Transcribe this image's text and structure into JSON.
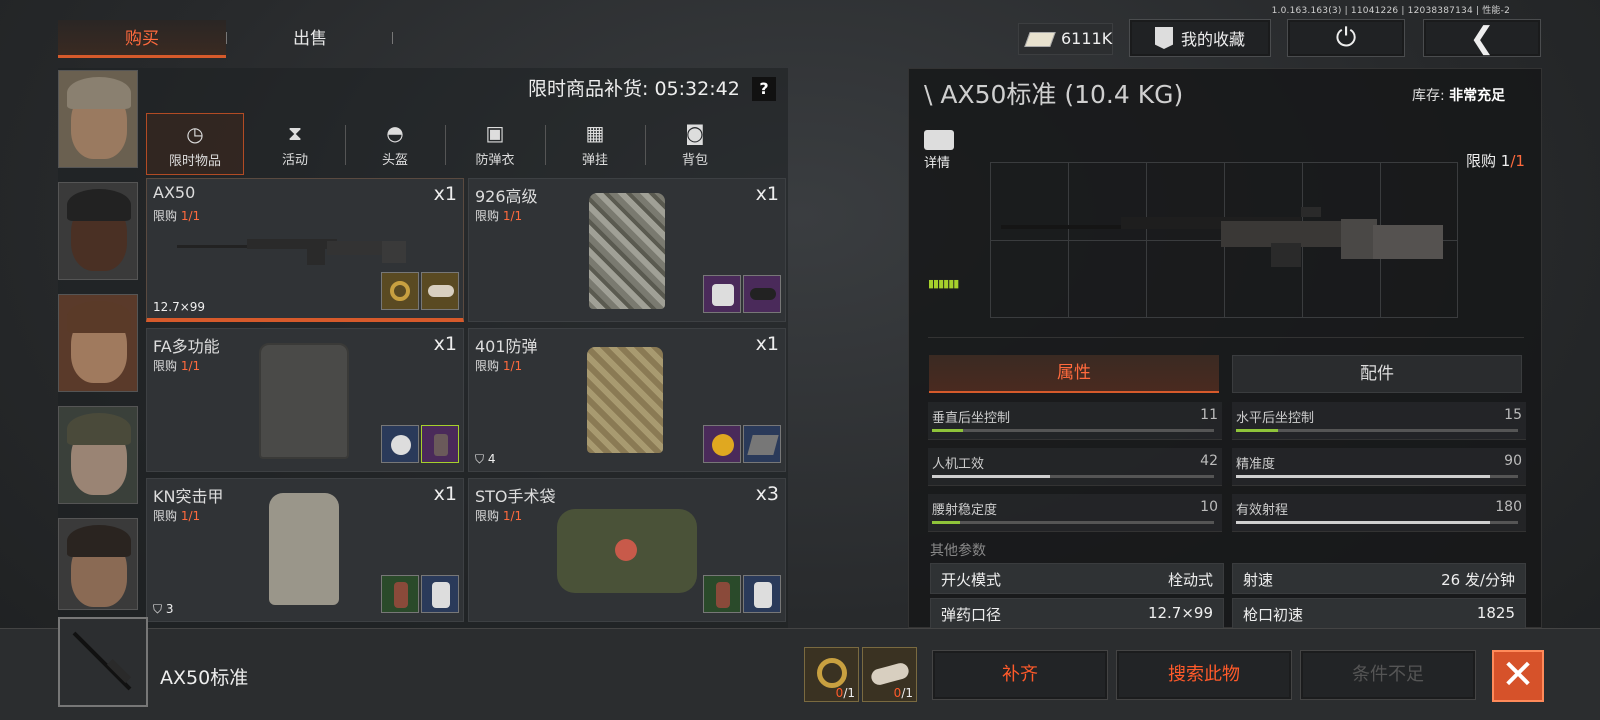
{
  "version": "1.0.163.163(3) | 11041226 | 12038387134 | 性能-2",
  "top_tabs": [
    {
      "label": "购买"
    },
    {
      "label": "出售"
    }
  ],
  "currency": {
    "value": "6111K"
  },
  "favorites": {
    "label": "我的收藏"
  },
  "restock": {
    "label": "限时商品补货:",
    "time": "05:32:42",
    "help": "?"
  },
  "categories": [
    {
      "label": "限时物品",
      "icon": "clock-icon"
    },
    {
      "label": "活动",
      "icon": "event-icon"
    },
    {
      "label": "头盔",
      "icon": "helmet-icon"
    },
    {
      "label": "防弹衣",
      "icon": "vest-icon"
    },
    {
      "label": "弹挂",
      "icon": "rig-icon"
    },
    {
      "label": "背包",
      "icon": "backpack-icon"
    }
  ],
  "items": [
    {
      "name": "AX50",
      "limit_label": "限购",
      "limit": "1/1",
      "qty": "x1",
      "tag": "12.7×99",
      "armor": "",
      "colors": [
        "#5a4a22",
        "#5a4a22"
      ]
    },
    {
      "name": "926高级",
      "limit_label": "限购",
      "limit": "1/1",
      "qty": "x1",
      "tag": "",
      "armor": "",
      "colors": [
        "#4a2a5a",
        "#4a2a5a"
      ]
    },
    {
      "name": "FA多功能",
      "limit_label": "限购",
      "limit": "1/1",
      "qty": "x1",
      "tag": "",
      "armor": "",
      "colors": [
        "#2a3a5a",
        "#4a2a5a"
      ]
    },
    {
      "name": "401防弹",
      "limit_label": "限购",
      "limit": "1/1",
      "qty": "x1",
      "tag": "",
      "armor": "4",
      "colors": [
        "#4a2a5a",
        "#2a3a5a"
      ]
    },
    {
      "name": "KN突击甲",
      "limit_label": "限购",
      "limit": "1/1",
      "qty": "x1",
      "tag": "",
      "armor": "3",
      "colors": [
        "#2a4a2a",
        "#2a3a5a"
      ]
    },
    {
      "name": "STO手术袋",
      "limit_label": "限购",
      "limit": "1/1",
      "qty": "x3",
      "tag": "",
      "armor": "",
      "colors": [
        "#2a4a2a",
        "#2a3a5a"
      ]
    }
  ],
  "detail": {
    "title": "\\ AX50标准 (10.4 KG)",
    "stock_label": "库存:",
    "stock_value": "非常充足",
    "detail_label": "详情",
    "limit_label": "限购",
    "limit_value": "1",
    "limit_total": "/1",
    "tabs": [
      {
        "label": "属性"
      },
      {
        "label": "配件"
      }
    ],
    "stats": [
      {
        "label": "垂直后坐控制",
        "value": "11",
        "level": 0.11
      },
      {
        "label": "水平后坐控制",
        "value": "15",
        "level": 0.15
      },
      {
        "label": "人机工效",
        "value": "42",
        "level": 0.42
      },
      {
        "label": "精准度",
        "value": "90",
        "level": 0.9
      },
      {
        "label": "腰射稳定度",
        "value": "10",
        "level": 0.1
      },
      {
        "label": "有效射程",
        "value": "180",
        "level": 0.9
      }
    ],
    "other_label": "其他参数",
    "params": [
      {
        "label": "开火模式",
        "value": "栓动式"
      },
      {
        "label": "射速",
        "value": "26 发/分钟"
      },
      {
        "label": "弹药口径",
        "value": "12.7×99"
      },
      {
        "label": "枪口初速",
        "value": "1825"
      }
    ]
  },
  "bottom": {
    "selected_name": "AX50标准",
    "materials": [
      {
        "have": "0",
        "need": "/1"
      },
      {
        "have": "0",
        "need": "/1"
      }
    ],
    "fill_label": "补齐",
    "search_label": "搜索此物",
    "cond_label": "条件不足"
  },
  "colors": {
    "accent": "#ff6a3d",
    "green": "#8fc43a"
  }
}
